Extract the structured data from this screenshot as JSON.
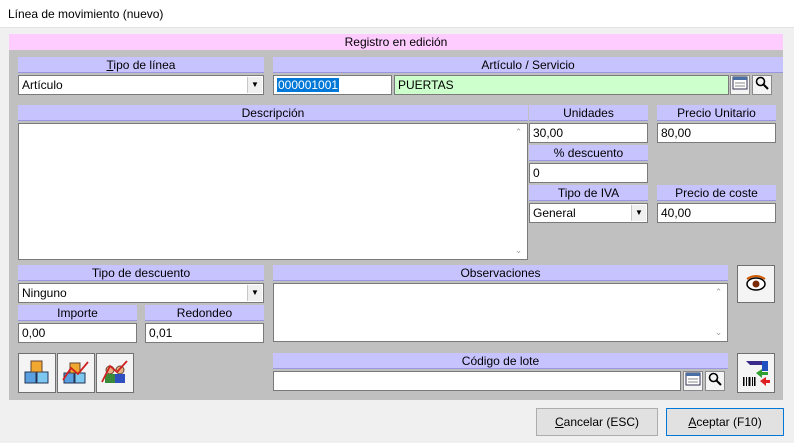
{
  "window": {
    "title": "Línea de movimiento (nuevo)"
  },
  "status": "Registro en edición",
  "tipo_linea": {
    "header_u": "T",
    "header_rest": "ipo de línea",
    "value": "Artículo"
  },
  "articulo": {
    "header": "Artículo / Servicio",
    "code": "000001001",
    "name": "PUERTAS"
  },
  "descripcion": {
    "header": "Descripción",
    "value": ""
  },
  "unidades": {
    "header": "Unidades",
    "value": "30,00"
  },
  "precio_unitario": {
    "header": "Precio Unitario",
    "value": "80,00"
  },
  "descuento": {
    "header": "% descuento",
    "value": "0"
  },
  "tipo_iva": {
    "header": "Tipo de IVA",
    "value": "General"
  },
  "precio_coste": {
    "header": "Precio de coste",
    "value": "40,00"
  },
  "tipo_descuento": {
    "header": "Tipo de descuento",
    "value": "Ninguno"
  },
  "importe": {
    "header": "Importe",
    "value": "0,00"
  },
  "redondeo": {
    "header": "Redondeo",
    "value": "0,01"
  },
  "observaciones": {
    "header": "Observaciones",
    "value": ""
  },
  "lote": {
    "header": "Código de lote",
    "value": ""
  },
  "buttons": {
    "cancel_u": "C",
    "cancel_rest": "ancelar (ESC)",
    "accept_u": "A",
    "accept_rest": "ceptar (F10)"
  },
  "colors": {
    "status_bg": "#ffccff",
    "header_bg": "#c6c3ff",
    "article_bg": "#ccffcc",
    "panel_bg": "#c0c0c0"
  }
}
